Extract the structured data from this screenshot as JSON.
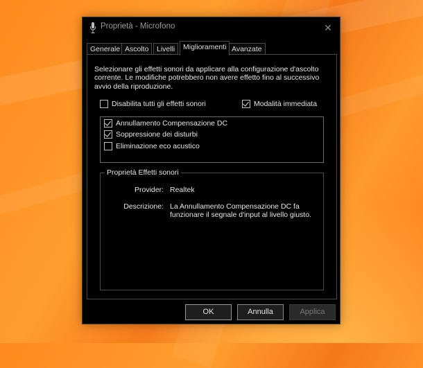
{
  "window": {
    "title": "Proprietà - Microfono"
  },
  "tabs": [
    {
      "label": "Generale"
    },
    {
      "label": "Ascolto"
    },
    {
      "label": "Livelli"
    },
    {
      "label": "Miglioramenti",
      "active": true
    },
    {
      "label": "Avanzate"
    }
  ],
  "enhancements": {
    "description": "Selezionare gli effetti sonori da applicare alla configurazione d'ascolto corrente. Le modifiche potrebbero non avere effetto fino al successivo avvio della riproduzione.",
    "disable_all": {
      "label": "Disabilita tutti gli effetti sonori",
      "checked": false
    },
    "immediate_mode": {
      "label": "Modalità immediata",
      "checked": true
    },
    "effects": [
      {
        "label": "Annullamento Compensazione DC",
        "checked": true
      },
      {
        "label": "Soppressione dei disturbi",
        "checked": true
      },
      {
        "label": "Eliminazione eco acustico",
        "checked": false
      }
    ],
    "properties": {
      "legend": "Proprietà Effetti sonori",
      "provider_label": "Provider:",
      "provider_value": "Realtek",
      "description_label": "Descrizione:",
      "description_value": "La Annullamento Compensazione DC fa funzionare il segnale d'input al livello giusto."
    }
  },
  "buttons": {
    "ok": "OK",
    "cancel": "Annulla",
    "apply": "Applica"
  },
  "icons": {
    "window": "microphone-icon",
    "close": "close-icon"
  }
}
